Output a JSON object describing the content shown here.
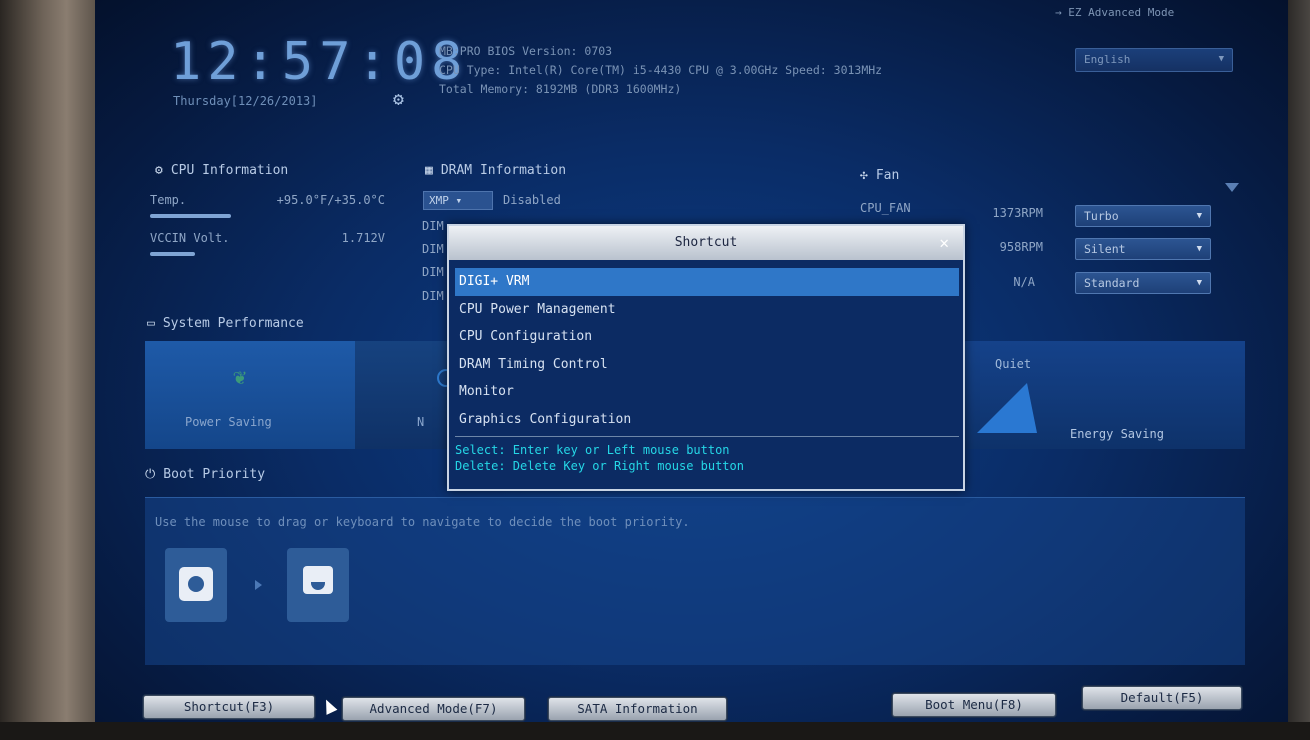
{
  "header": {
    "clock": "12:57:08",
    "date": "Thursday[12/26/2013]",
    "bios_line": "MB:PRO   BIOS Version: 0703",
    "cpu_line": "CPU Type: Intel(R) Core(TM) i5-4430 CPU @ 3.00GHz   Speed: 3013MHz",
    "memory_line": "Total Memory: 8192MB (DDR3 1600MHz)",
    "language": "English",
    "top_right": "→ EZ Advanced Mode"
  },
  "cpu_info": {
    "title": "CPU Information",
    "temp_label": "Temp.",
    "temp_value": "+95.0°F/+35.0°C",
    "volt_label": "VCCIN Volt.",
    "volt_value": "1.712V",
    "temp_level": 0.45,
    "volt_level": 0.25
  },
  "dram_info": {
    "title": "DRAM Information",
    "xmp_label": "XMP ▾",
    "xmp_value": "Disabled",
    "dimms": [
      "DIM",
      "DIM",
      "DIM",
      "DIM"
    ]
  },
  "fan": {
    "title": "Fan",
    "rows": [
      {
        "name": "CPU_FAN",
        "rpm": "1373RPM",
        "mode": "Turbo"
      },
      {
        "name": "",
        "rpm": "958RPM",
        "mode": "Silent"
      },
      {
        "name": "",
        "rpm": "N/A",
        "mode": "Standard"
      }
    ]
  },
  "system_performance": {
    "title": "System Performance",
    "power_saving": "Power Saving",
    "normal_partial": "N",
    "quiet": "Quiet",
    "energy_saving": "Energy Saving"
  },
  "boot_priority": {
    "title": "Boot Priority",
    "hint": "Use the mouse to drag or keyboard to navigate to decide the boot priority."
  },
  "buttons": {
    "shortcut": "Shortcut(F3)",
    "advanced": "Advanced Mode(F7)",
    "sata": "SATA Information",
    "boot_menu": "Boot Menu(F8)",
    "default": "Default(F5)"
  },
  "shortcut_dialog": {
    "title": "Shortcut",
    "close": "✕",
    "items": [
      "DIGI+ VRM",
      "CPU Power Management",
      "CPU Configuration",
      "DRAM Timing Control",
      "Monitor",
      "Graphics Configuration"
    ],
    "selected_index": 0,
    "help_select": "Select: Enter key or Left mouse button",
    "help_delete": "Delete: Delete Key or Right mouse button"
  },
  "colors": {
    "screen_bg": "#0a2c66",
    "selection": "#2f77c8",
    "help_text": "#25d7e6"
  }
}
